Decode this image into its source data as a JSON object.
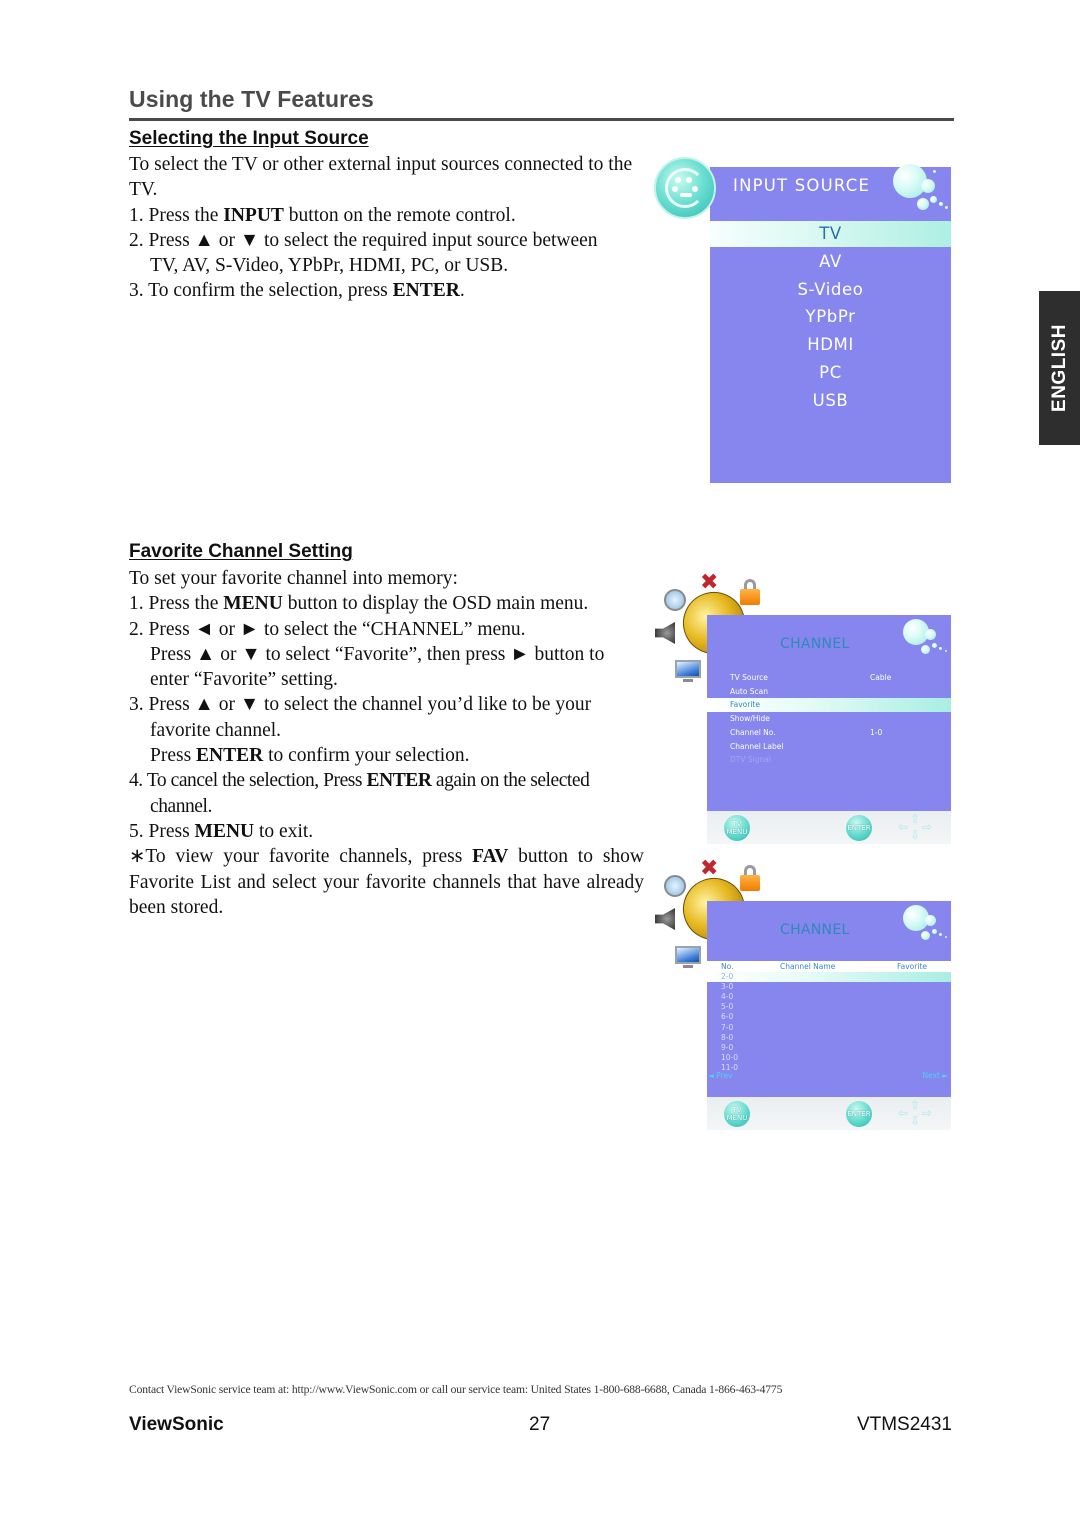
{
  "page": {
    "title": "Using the TV Features",
    "side_tab": "ENGLISH"
  },
  "input_section": {
    "heading": "Selecting the Input Source",
    "intro": "To select the TV or other external input sources connected to the TV.",
    "steps": [
      {
        "num": "1. ",
        "pre": "Press the ",
        "bold": "INPUT",
        "post": " button on the remote control."
      },
      {
        "num": "2. ",
        "pre": "Press ▲ or ▼ to select the required input source between",
        "line2": "TV, AV, S-Video, YPbPr, HDMI, PC, or USB."
      },
      {
        "num": "3. ",
        "pre": "To confirm the selection, press ",
        "bold": "ENTER",
        "post": "."
      }
    ]
  },
  "input_osd": {
    "title": "INPUT SOURCE",
    "items": [
      "TV",
      "AV",
      "S-Video",
      "YPbPr",
      "HDMI",
      "PC",
      "USB"
    ],
    "selected_index": 0,
    "colors": {
      "panel": "#8686ee",
      "highlight_text": "#2b6fa8"
    }
  },
  "favorite_section": {
    "heading": "Favorite Channel Setting",
    "intro": "To set your favorite channel into memory:",
    "step1": {
      "num": "1. ",
      "pre": "Press the ",
      "bold": "MENU",
      "post": " button to display the OSD main menu."
    },
    "step2a": {
      "num": "2. ",
      "text": "Press ◄ or ► to select the “CHANNEL” menu."
    },
    "step2b": "Press ▲ or ▼ to select “Favorite”, then press ► button to enter “Favorite” setting.",
    "step3": {
      "num": "3. ",
      "text": "Press ▲ or ▼ to select the channel you’d like to be your favorite channel."
    },
    "step3b": {
      "pre": "Press ",
      "bold": "ENTER",
      "post": " to confirm your selection."
    },
    "step4": {
      "num": "4. ",
      "pre": "To cancel the selection, Press ",
      "bold": "ENTER",
      "post": " again on the selected channel."
    },
    "step5": {
      "num": "5. ",
      "pre": "Press ",
      "bold": "MENU",
      "post": " to exit."
    },
    "note": {
      "pre": "∗To view your favorite channels, press ",
      "bold": "FAV",
      "post": " button to show Favorite List and select your favorite channels that have already been stored."
    }
  },
  "channel_osd": {
    "title": "CHANNEL",
    "rows": [
      {
        "label": "TV Source",
        "value": "Cable",
        "state": "normal"
      },
      {
        "label": "Auto Scan",
        "value": "",
        "state": "normal"
      },
      {
        "label": "Favorite",
        "value": "",
        "state": "selected"
      },
      {
        "label": "Show/Hide",
        "value": "",
        "state": "normal"
      },
      {
        "label": "Channel No.",
        "value": "1-0",
        "state": "normal"
      },
      {
        "label": "Channel Label",
        "value": "",
        "state": "normal"
      },
      {
        "label": "DTV Signal",
        "value": "",
        "state": "disabled"
      }
    ],
    "buttons": {
      "menu": "TV MENU",
      "enter": "ENTER"
    }
  },
  "favorite_osd": {
    "title": "CHANNEL",
    "columns": [
      "No.",
      "Channel Name",
      "Favorite"
    ],
    "channels": [
      "2-0",
      "3-0",
      "4-0",
      "5-0",
      "6-0",
      "7-0",
      "8-0",
      "9-0",
      "10-0",
      "11-0"
    ],
    "selected_index": 0,
    "prev_label": "◄ Prev",
    "next_label": "Next ►",
    "buttons": {
      "menu": "TV MENU",
      "enter": "ENTER"
    }
  },
  "footer": {
    "contact": "Contact ViewSonic service team at: http://www.ViewSonic.com or call our service team: United States 1-800-688-6688, Canada 1-866-463-4775",
    "brand": "ViewSonic",
    "page_number": "27",
    "model": "VTMS2431"
  }
}
